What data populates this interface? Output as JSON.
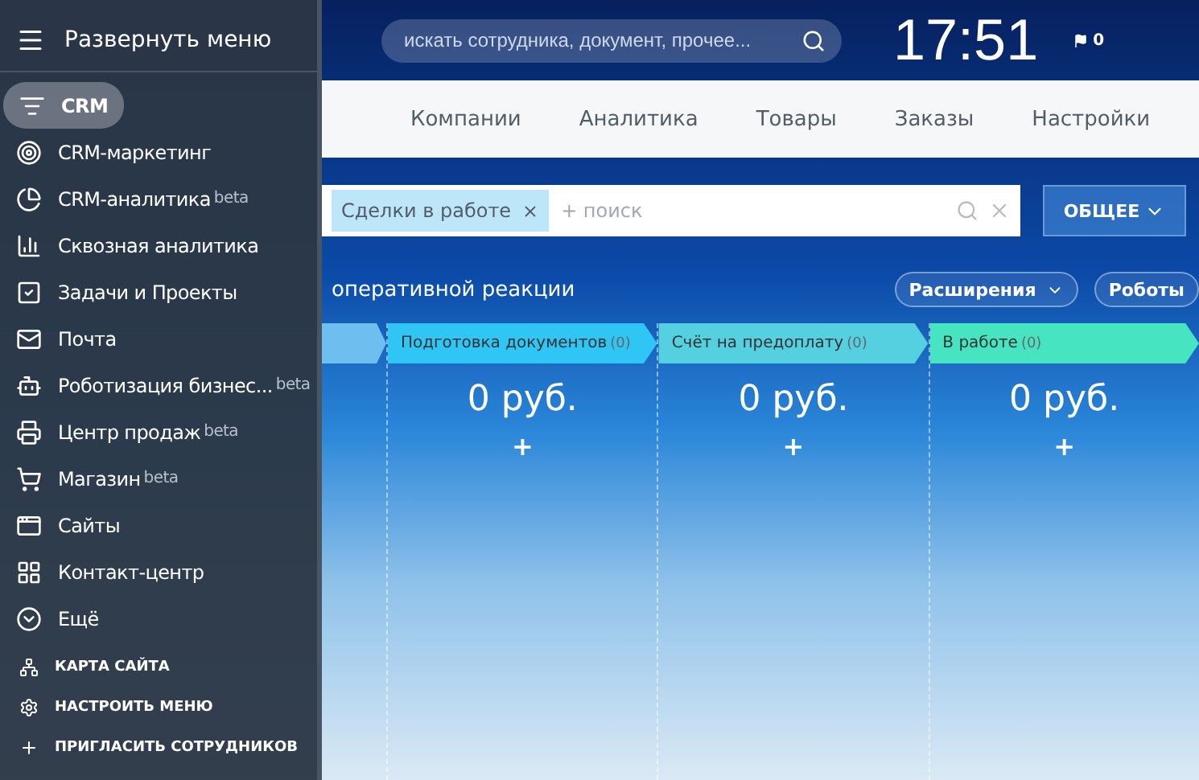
{
  "sidebar": {
    "toggle": "Развернуть меню",
    "items": [
      {
        "label": "CRM",
        "selected": true
      },
      {
        "label": "CRM-маркетинг",
        "selected": false
      },
      {
        "label": "CRM-аналитика",
        "badge": "beta",
        "selected": false
      },
      {
        "label": "Сквозная аналитика",
        "selected": false
      },
      {
        "label": "Задачи и Проекты",
        "selected": false
      },
      {
        "label": "Почта",
        "selected": false
      },
      {
        "label": "Роботизация бизнес...",
        "badge": "beta",
        "selected": false
      },
      {
        "label": "Центр продаж",
        "badge": "beta",
        "selected": false
      },
      {
        "label": "Магазин",
        "badge": "beta",
        "selected": false
      },
      {
        "label": "Сайты",
        "selected": false
      },
      {
        "label": "Контакт-центр",
        "selected": false
      },
      {
        "label": "Ещё",
        "selected": false
      }
    ],
    "links": [
      "КАРТА САЙТА",
      "НАСТРОИТЬ МЕНЮ",
      "ПРИГЛАСИТЬ СОТРУДНИКОВ"
    ]
  },
  "header": {
    "search": {
      "placeholder": "искать сотрудника, документ, прочее..."
    },
    "clock": "17:51",
    "flag_count": "0"
  },
  "tabs": [
    "Компании",
    "Аналитика",
    "Товары",
    "Заказы",
    "Настройки"
  ],
  "filter": {
    "chip": "Сделки в работе",
    "placeholder": "+ поиск",
    "preset": "ОБЩЕЕ"
  },
  "toolbar": {
    "heading": "оперативной реакции",
    "extensions": "Расширения",
    "robots": "Роботы"
  },
  "stages": [
    {
      "name": "Подготовка документов",
      "count": "(0)",
      "sum": "0 руб.",
      "add": "+",
      "color": "#2fc6f6"
    },
    {
      "name": "Счёт на предоплату",
      "count": "(0)",
      "sum": "0 руб.",
      "add": "+",
      "color": "#55d0e0"
    },
    {
      "name": "В работе",
      "count": "(0)",
      "sum": "0 руб.",
      "add": "+",
      "color": "#47e4c2"
    }
  ]
}
